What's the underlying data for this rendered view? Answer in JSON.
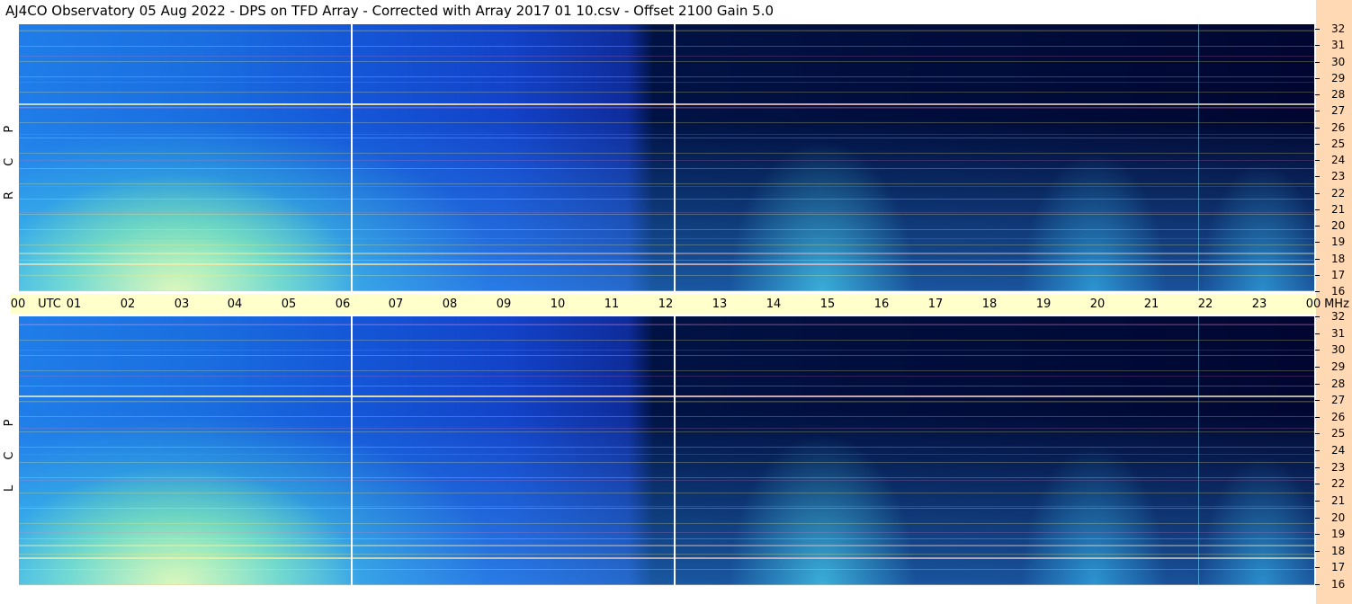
{
  "title": "AJ4CO Observatory  05 Aug 2022  -  DPS on TFD Array  -  Corrected with Array 2017 01 10.csv  -  Offset 2100  Gain 5.0",
  "panels": [
    {
      "name": "rcp",
      "label": "R C P"
    },
    {
      "name": "lcp",
      "label": "L C P"
    }
  ],
  "time_axis": {
    "labels": [
      "00",
      "UTC",
      "01",
      "02",
      "03",
      "04",
      "05",
      "06",
      "07",
      "08",
      "09",
      "10",
      "11",
      "12",
      "13",
      "14",
      "15",
      "16",
      "17",
      "18",
      "19",
      "20",
      "21",
      "22",
      "23",
      "00",
      "MHz"
    ]
  },
  "freq_axis": {
    "labels": [
      "32",
      "31",
      "30",
      "29",
      "28",
      "27",
      "26",
      "25",
      "24",
      "23",
      "22",
      "21",
      "20",
      "19",
      "18",
      "17",
      "16"
    ]
  },
  "colors": {
    "background": "#ffffff",
    "time_strip": "#ffffcc",
    "freq_strip": "#ffd9b3",
    "marker_line": "#ffffff"
  }
}
